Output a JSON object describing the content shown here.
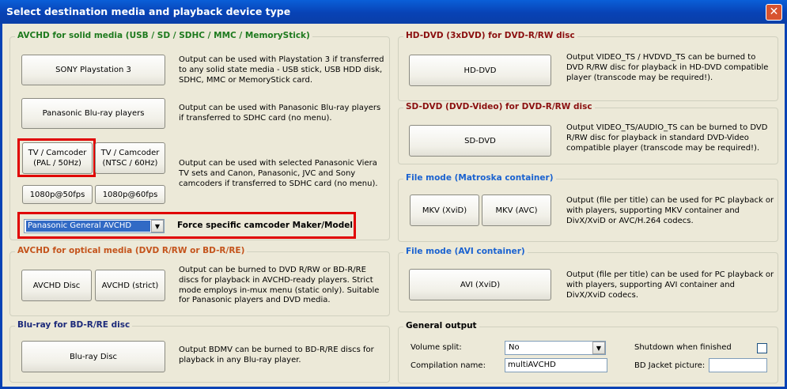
{
  "window": {
    "title": "Select destination media and playback device type",
    "close_glyph": "✕"
  },
  "avchd_solid": {
    "title": "AVCHD for solid media (USB / SD / SDHC / MMC / MemoryStick)",
    "ps3_button": "SONY Playstation 3",
    "ps3_desc": "Output can be used with Playstation 3 if transferred to any solid state media - USB stick, USB HDD disk, SDHC, MMC or MemoryStick card.",
    "panasonic_bd_button": "Panasonic Blu-ray players",
    "panasonic_bd_desc": "Output can be used with Panasonic Blu-ray players if transferred to SDHC card (no menu).",
    "tv_pal_button_l1": "TV / Camcoder",
    "tv_pal_button_l2": "(PAL / 50Hz)",
    "tv_ntsc_button_l1": "TV / Camcoder",
    "tv_ntsc_button_l2": "(NTSC / 60Hz)",
    "tv_desc": "Output can be used with selected Panasonic Viera TV sets and Canon, Panasonic, JVC and Sony camcoders if transferred to SDHC card (no menu).",
    "p50_button": "1080p@50fps",
    "p60_button": "1080p@60fps",
    "maker_select": "Panasonic General AVCHD",
    "force_label": "Force specific camcoder Maker/Model"
  },
  "avchd_optical": {
    "title": "AVCHD for optical media (DVD R/RW or BD-R/RE)",
    "disc_button": "AVCHD Disc",
    "strict_button": "AVCHD (strict)",
    "desc": "Output can be burned to DVD R/RW or BD-R/RE discs for playback in AVCHD-ready players. Strict mode employs in-mux menu (static only). Suitable for Panasonic players and DVD media."
  },
  "bluray": {
    "title": "Blu-ray for BD-R/RE disc",
    "button": "Blu-ray Disc",
    "desc": "Output BDMV can be burned to BD-R/RE discs for playback in any Blu-ray player."
  },
  "hddvd": {
    "title": "HD-DVD (3xDVD) for DVD-R/RW disc",
    "button": "HD-DVD",
    "desc": "Output VIDEO_TS / HVDVD_TS can be burned to DVD R/RW disc for playback in HD-DVD compatible player (transcode may be required!)."
  },
  "sddvd": {
    "title": "SD-DVD (DVD-Video) for DVD-R/RW disc",
    "button": "SD-DVD",
    "desc": "Output VIDEO_TS/AUDIO_TS can be burned to DVD R/RW disc for playback in standard DVD-Video compatible player (transcode may be required!)."
  },
  "matroska": {
    "title": "File mode (Matroska container)",
    "xvid_button": "MKV (XviD)",
    "avc_button": "MKV (AVC)",
    "desc": "Output (file per title) can be used for PC playback or with players, supporting MKV container and DivX/XviD or AVC/H.264 codecs."
  },
  "avi": {
    "title": "File mode (AVI container)",
    "button": "AVI (XviD)",
    "desc": "Output (file per title) can be used for PC playback or with players, supporting AVI container and DivX/XviD codecs."
  },
  "general": {
    "title": "General output",
    "volume_split_label": "Volume split:",
    "volume_split_value": "No",
    "compilation_label": "Compilation name:",
    "compilation_value": "multiAVCHD",
    "shutdown_label": "Shutdown when finished",
    "jacket_label": "BD Jacket picture:",
    "jacket_value": ""
  },
  "colors": {
    "green_title": "#1e7a1e",
    "orange_title": "#c4541c",
    "navy_title": "#1c2a7a",
    "maroon_title": "#8b1010",
    "blue_title": "#1a62d0",
    "highlight": "#e00000"
  }
}
